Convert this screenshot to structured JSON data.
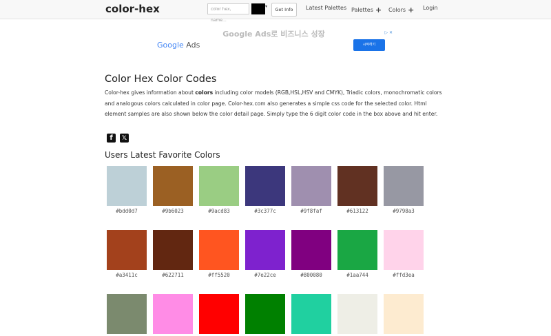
{
  "navbar": {
    "brand": "color-hex",
    "search_placeholder": "color hex, name...",
    "picker_color": "#000000",
    "get_info": "Get Info",
    "links": [
      "Latest Palettes",
      "Palettes",
      "Colors",
      "Login"
    ]
  },
  "ad": {
    "headline": "Google Ads로 비즈니스 성장",
    "google": "Google",
    "ads": "Ads",
    "badge": "▷ ✕",
    "cta": "시작하기"
  },
  "main": {
    "title": "Color Hex Color Codes",
    "desc_pre": "Color-hex gives information about ",
    "desc_bold": "colors",
    "desc_post": " including color models (RGB,HSL,HSV and CMYK), Triadic colors, monochromatic colors and analogous colors calculated in color page. Color-hex.com also generates a simple css code for the selected color. Html element samples are also shown below the color detail page. Simply type the 6 digit color code in the box above and hit enter.",
    "social": {
      "facebook": "f",
      "x": "𝕏"
    },
    "favorites_title": "Users Latest Favorite Colors"
  },
  "colors": [
    {
      "hex": "#bdd0d7",
      "label": "#bdd0d7"
    },
    {
      "hex": "#9b6023",
      "label": "#9b6023"
    },
    {
      "hex": "#9acd83",
      "label": "#9acd83"
    },
    {
      "hex": "#3c377c",
      "label": "#3c377c"
    },
    {
      "hex": "#9f8faf",
      "label": "#9f8faf"
    },
    {
      "hex": "#613122",
      "label": "#613122"
    },
    {
      "hex": "#9798a3",
      "label": "#9798a3"
    },
    {
      "hex": "#a3411c",
      "label": "#a3411c"
    },
    {
      "hex": "#622711",
      "label": "#622711"
    },
    {
      "hex": "#ff5520",
      "label": "#ff5520"
    },
    {
      "hex": "#7e22ce",
      "label": "#7e22ce"
    },
    {
      "hex": "#800080",
      "label": "#800080"
    },
    {
      "hex": "#1aa744",
      "label": "#1aa744"
    },
    {
      "hex": "#ffd3ea",
      "label": "#ffd3ea"
    },
    {
      "hex": "#7b8a6e",
      "label": ""
    },
    {
      "hex": "#ff8ce6",
      "label": ""
    },
    {
      "hex": "#ff0000",
      "label": ""
    },
    {
      "hex": "#008000",
      "label": ""
    },
    {
      "hex": "#20d0a0",
      "label": ""
    },
    {
      "hex": "#eeeee6",
      "label": ""
    },
    {
      "hex": "#fdebd0",
      "label": ""
    }
  ]
}
